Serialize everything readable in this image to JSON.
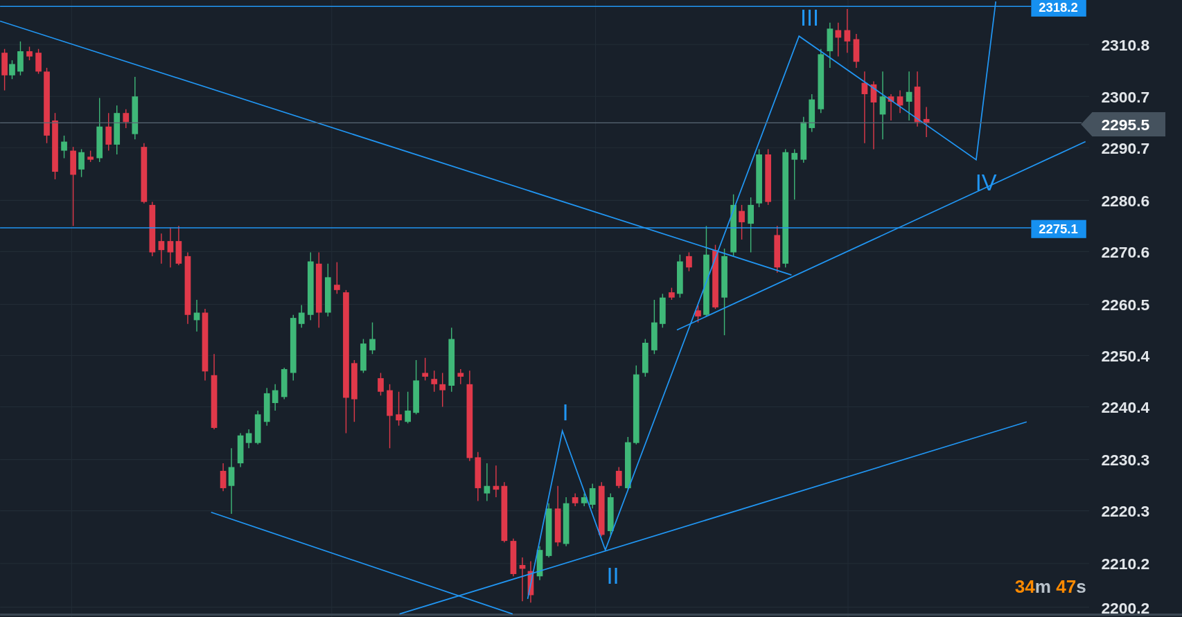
{
  "price_axis": {
    "labels": [
      "2310.8",
      "2300.7",
      "2290.7",
      "2280.6",
      "2270.6",
      "2260.5",
      "2250.4",
      "2240.4",
      "2230.3",
      "2220.3",
      "2210.2",
      "2200.2"
    ]
  },
  "price_tags": [
    {
      "kind": "level",
      "text": "2318.2"
    },
    {
      "kind": "current",
      "text": "2295.5"
    },
    {
      "kind": "level",
      "text": "2275.1"
    }
  ],
  "wave_labels": [
    "III",
    "IV",
    "I",
    "II"
  ],
  "countdown": [
    {
      "kind": "value",
      "text": "34"
    },
    {
      "kind": "unit",
      "text": "m"
    },
    {
      "kind": "value",
      "text": " 47"
    },
    {
      "kind": "unit",
      "text": "s"
    }
  ]
}
